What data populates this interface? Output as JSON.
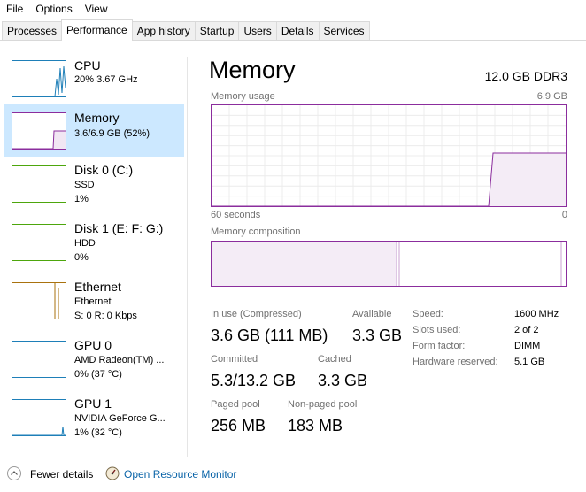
{
  "menu": [
    "File",
    "Options",
    "View"
  ],
  "tabs": [
    "Processes",
    "Performance",
    "App history",
    "Startup",
    "Users",
    "Details",
    "Services"
  ],
  "sidebar": {
    "items": [
      {
        "name": "CPU",
        "line1": "20%  3.67 GHz",
        "line2": "",
        "color": "#1e7fb8"
      },
      {
        "name": "Memory",
        "line1": "3.6/6.9 GB (52%)",
        "line2": "",
        "color": "#8b2d9d"
      },
      {
        "name": "Disk 0 (C:)",
        "line1": "SSD",
        "line2": "1%",
        "color": "#4da60c"
      },
      {
        "name": "Disk 1 (E: F: G:)",
        "line1": "HDD",
        "line2": "0%",
        "color": "#4da60c"
      },
      {
        "name": "Ethernet",
        "line1": "Ethernet",
        "line2": "S: 0  R: 0 Kbps",
        "color": "#a9720e"
      },
      {
        "name": "GPU 0",
        "line1": "AMD Radeon(TM) ...",
        "line2": "0%  (37 °C)",
        "color": "#1e7fb8"
      },
      {
        "name": "GPU 1",
        "line1": "NVIDIA GeForce G...",
        "line2": "1%  (32 °C)",
        "color": "#1e7fb8"
      }
    ]
  },
  "main": {
    "title": "Memory",
    "subtitle": "12.0 GB DDR3",
    "usage_label": "Memory usage",
    "usage_max": "6.9 GB",
    "time_left": "60 seconds",
    "time_right": "0",
    "composition_label": "Memory composition",
    "in_use_label": "In use (Compressed)",
    "in_use_value": "3.6 GB (111 MB)",
    "available_label": "Available",
    "available_value": "3.3 GB",
    "committed_label": "Committed",
    "committed_value": "5.3/13.2 GB",
    "cached_label": "Cached",
    "cached_value": "3.3 GB",
    "paged_label": "Paged pool",
    "paged_value": "256 MB",
    "nonpaged_label": "Non-paged pool",
    "nonpaged_value": "183 MB",
    "speed_label": "Speed:",
    "speed_value": "1600 MHz",
    "slots_label": "Slots used:",
    "slots_value": "2 of 2",
    "form_label": "Form factor:",
    "form_value": "DIMM",
    "hw_label": "Hardware reserved:",
    "hw_value": "5.1 GB",
    "accent": "#8b2d9d"
  },
  "bottom": {
    "fewer": "Fewer details",
    "resource_monitor": "Open Resource Monitor"
  }
}
